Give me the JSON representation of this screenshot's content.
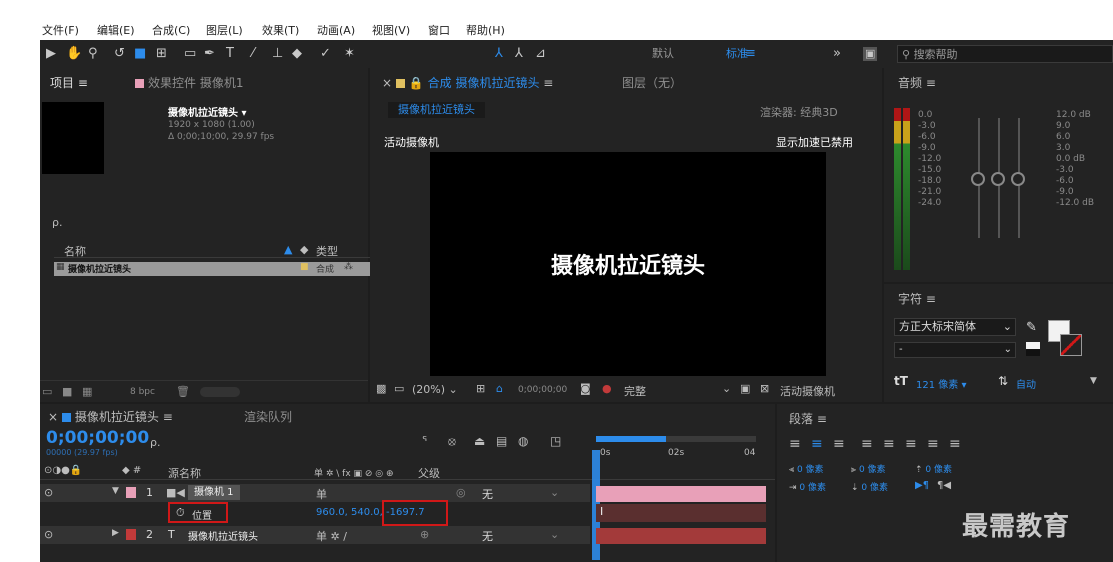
{
  "menu": [
    "文件(F)",
    "编辑(E)",
    "合成(C)",
    "图层(L)",
    "效果(T)",
    "动画(A)",
    "视图(V)",
    "窗口",
    "帮助(H)"
  ],
  "toolbar": {
    "workspace_default": "默认",
    "workspace_standard": "标准",
    "overflow": "»",
    "help_placeholder": "搜索帮助"
  },
  "project": {
    "tab": "项目",
    "effects_tab": "效果控件 摄像机1",
    "comp_name": "摄像机拉近镜头",
    "comp_res": "1920 x 1080 (1.00)",
    "comp_dur": "Δ 0;00;10;00, 29.97 fps",
    "search_placeholder": "ρ.",
    "col_name": "名称",
    "col_type": "类型",
    "item_name": "摄像机拉近镜头",
    "item_type": "合成",
    "bpc": "8 bpc"
  },
  "composition": {
    "tab": "合成 摄像机拉近镜头",
    "layer_tab": "图层（无）",
    "comp_chip": "摄像机拉近镜头",
    "renderer": "渲染器:  经典3D",
    "active_camera": "活动摄像机",
    "gpu_note": "显示加速已禁用",
    "canvas_text": "摄像机拉近镜头",
    "zoom": "(20%)",
    "timecode": "0;00;00;00",
    "quality": "完整",
    "view": "活动摄像机"
  },
  "audio": {
    "tab": "音频",
    "left_scale": [
      "0.0",
      "-3.0",
      "-6.0",
      "-9.0",
      "-12.0",
      "-15.0",
      "-18.0",
      "-21.0",
      "-24.0"
    ],
    "right_scale": [
      "12.0 dB",
      "9.0",
      "6.0",
      "3.0",
      "0.0 dB",
      "-3.0",
      "-6.0",
      "-9.0",
      "-12.0 dB"
    ]
  },
  "character": {
    "tab": "字符",
    "font": "方正大标宋简体",
    "style": "-",
    "size": "121 像素",
    "leading": "自动"
  },
  "paragraph": {
    "tab": "段落",
    "indent_left": "0 像素",
    "indent_right": "0 像素",
    "space_before": "0 像素",
    "space_after": "0 像素",
    "indent_first": "0 像素"
  },
  "timeline": {
    "tab": "摄像机拉近镜头",
    "render_tab": "渲染队列",
    "timecode": "0;00;00;00",
    "fps": "00000 (29.97 fps)",
    "col_source": "源名称",
    "col_parent": "父级",
    "switch_header": "单 ✲ \\ fx ▣ ⊘ ◎ ⊕",
    "ruler": [
      "0s",
      "02s",
      "04"
    ],
    "layers": [
      {
        "num": "1",
        "name": "摄像机 1",
        "parent": "无",
        "switch": "单"
      },
      {
        "num": "2",
        "name": "摄像机拉近镜头",
        "parent": "无",
        "switch": "单 ✲ /"
      }
    ],
    "position_label": "位置",
    "position_xy": "960.0, 540.0,",
    "position_z": "-1697.7"
  },
  "watermark": "最需教育",
  "colors": {
    "accent": "#2d8ceb",
    "highlight": "#d01818",
    "layer1": "#e8a0b8",
    "layer2": "#c23a3a"
  }
}
